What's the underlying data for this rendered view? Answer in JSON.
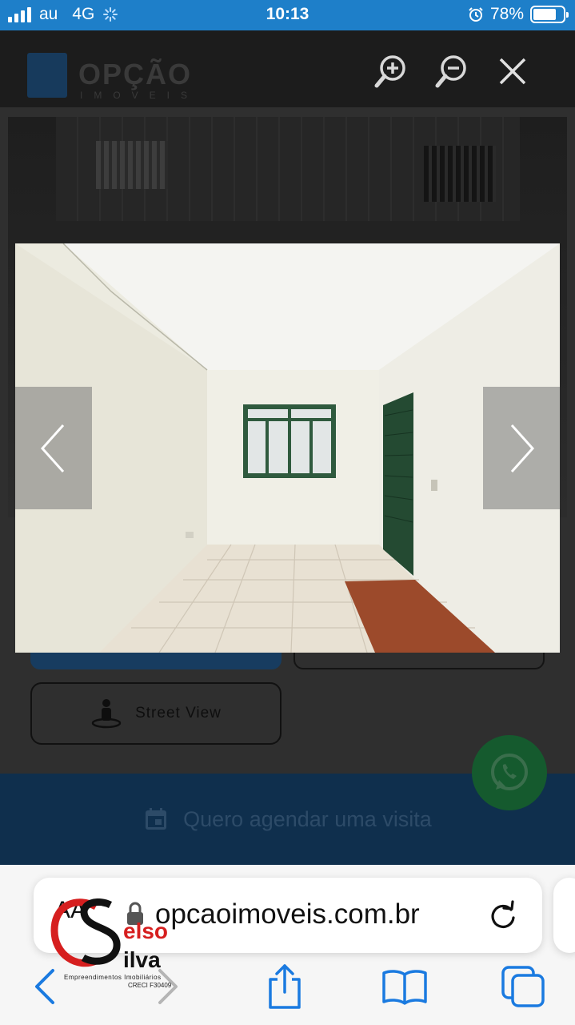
{
  "status_bar": {
    "carrier": "au",
    "network": "4G",
    "time": "10:13",
    "battery": "78%",
    "battery_level": 0.78
  },
  "site": {
    "logo_text": "OPÇÃO",
    "logo_subtext": "IMOVEIS",
    "zoom_in": "zoom-in-icon",
    "zoom_out": "zoom-out-icon",
    "close": "close-icon",
    "street_view_label": "Street View",
    "visit_label": "Quero agendar uma visita"
  },
  "lightbox": {
    "prev": "chevron-left-icon",
    "next": "chevron-right-icon"
  },
  "browser": {
    "text_size_button": "AA",
    "url": "opcaoimoveis.com.br",
    "reload": "reload-icon",
    "toolbar": [
      "back-icon",
      "forward-icon",
      "share-icon",
      "bookmarks-icon",
      "tabs-icon"
    ]
  },
  "watermark": {
    "name_line1": "elso",
    "name_line2": "ilva",
    "subtitle": "Empreendimentos Imobiliários",
    "creci": "CRECI F30409"
  },
  "colors": {
    "status_bar": "#1e7fc9",
    "ios_blue": "#1a7ae0",
    "watermark_red": "#d61f1f"
  }
}
